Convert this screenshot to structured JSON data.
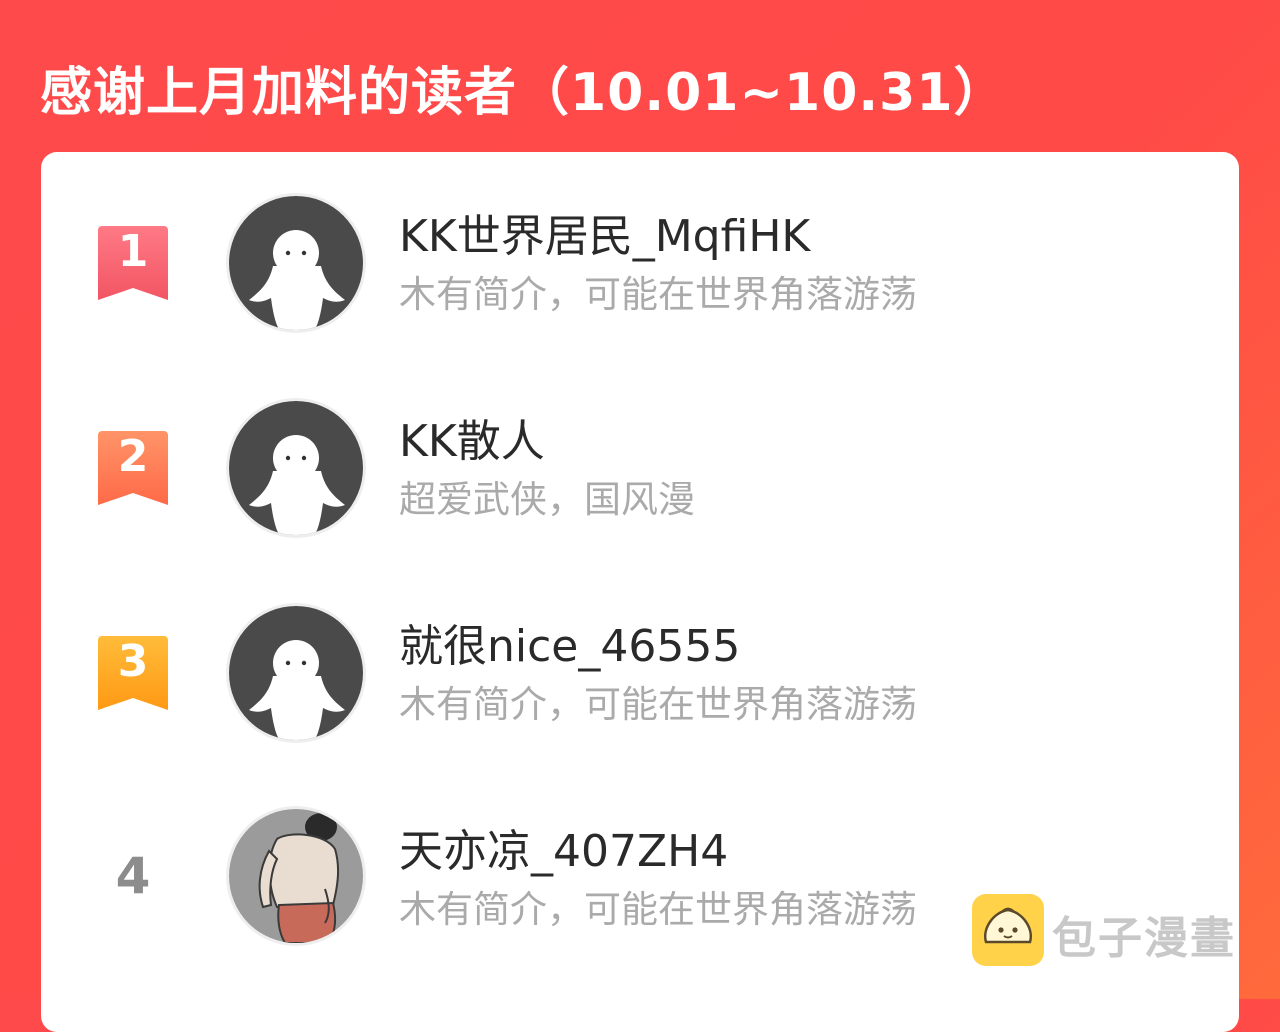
{
  "header": {
    "title": "感谢上月加料的读者（10.01~10.31）"
  },
  "colors": {
    "background": "#ff4a4c",
    "rank1": "#f7606a",
    "rank2": "#ff7a55",
    "rank3": "#ffa422",
    "card": "#ffffff"
  },
  "readers": [
    {
      "rank": "1",
      "name": "KK世界居民_MqfiHK",
      "bio": "木有简介，可能在世界角落游荡",
      "avatar": "default-ghost-avatar"
    },
    {
      "rank": "2",
      "name": "KK散人",
      "bio": "超爱武侠，国风漫",
      "avatar": "default-ghost-avatar"
    },
    {
      "rank": "3",
      "name": "就很nice_46555",
      "bio": "木有简介，可能在世界角落游荡",
      "avatar": "default-ghost-avatar"
    },
    {
      "rank": "4",
      "name": "天亦凉_407ZH4",
      "bio": "木有简介，可能在世界角落游荡",
      "avatar": "illustrated-person-avatar"
    }
  ],
  "watermark": {
    "text": "包子漫畫",
    "icon": "bun-logo-icon"
  }
}
